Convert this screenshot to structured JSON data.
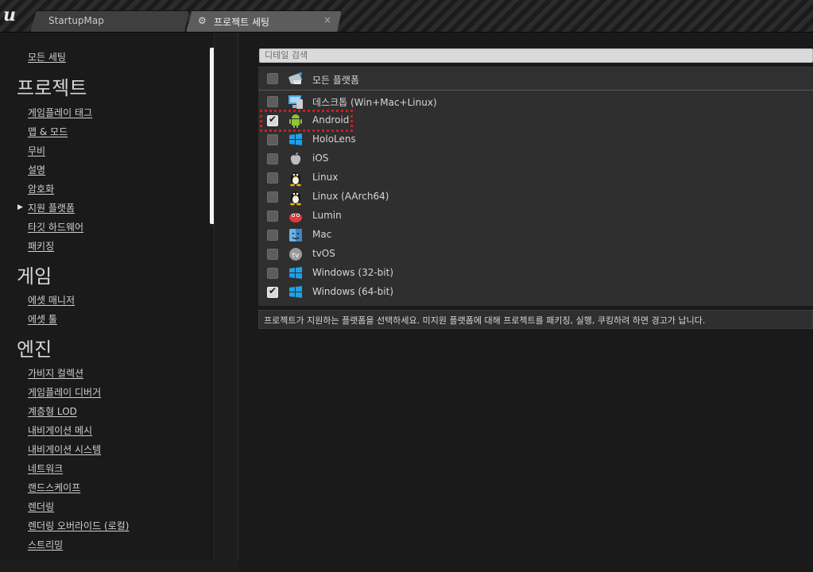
{
  "window": {
    "tabs": [
      {
        "label": "StartupMap",
        "active": false
      },
      {
        "label": "프로젝트 세팅",
        "active": true
      }
    ],
    "close_glyph": "×"
  },
  "sidebar": {
    "all_settings": "모든 세팅",
    "sections": [
      {
        "title": "프로젝트",
        "items": [
          "게임플레이 태그",
          "맵 & 모드",
          "무비",
          "설명",
          "암호화",
          "지원 플랫폼",
          "타깃 하드웨어",
          "패키징"
        ]
      },
      {
        "title": "게임",
        "items": [
          "에셋 매니저",
          "에셋 툴"
        ]
      },
      {
        "title": "엔진",
        "items": [
          "가비지 컬렉션",
          "게임플레이 디버거",
          "계층형 LOD",
          "내비게이션 메시",
          "내비게이션 시스템",
          "네트워크",
          "랜드스케이프",
          "렌더링",
          "렌더링 오버라이드 (로컬)",
          "스트리밍"
        ]
      }
    ],
    "active_item": "지원 플랫폼"
  },
  "details": {
    "search_placeholder": "디테일 검색",
    "header": {
      "label": "모든 플랫폼",
      "checked": false,
      "icon": "all-platforms-icon"
    },
    "platforms": [
      {
        "label": "데스크톱 (Win+Mac+Linux)",
        "checked": false,
        "icon": "desktop-icon"
      },
      {
        "label": "Android",
        "checked": true,
        "icon": "android-icon",
        "highlighted": true
      },
      {
        "label": "HoloLens",
        "checked": false,
        "icon": "windows-icon"
      },
      {
        "label": "iOS",
        "checked": false,
        "icon": "apple-icon"
      },
      {
        "label": "Linux",
        "checked": false,
        "icon": "linux-icon"
      },
      {
        "label": "Linux (AArch64)",
        "checked": false,
        "icon": "linux-icon"
      },
      {
        "label": "Lumin",
        "checked": false,
        "icon": "lumin-icon"
      },
      {
        "label": "Mac",
        "checked": false,
        "icon": "mac-icon"
      },
      {
        "label": "tvOS",
        "checked": false,
        "icon": "tvos-icon"
      },
      {
        "label": "Windows (32-bit)",
        "checked": false,
        "icon": "windows-icon"
      },
      {
        "label": "Windows (64-bit)",
        "checked": true,
        "icon": "windows-icon"
      }
    ],
    "description": "프로젝트가 지원하는 플랫폼을 선택하세요. 미지원 플랫폼에 대해 프로젝트를 패키징, 실행, 쿠킹하려 하면 경고가 납니다."
  },
  "colors": {
    "highlight": "#d21c1c",
    "android": "#8fc43d",
    "windows": "#1ea1e6",
    "lumin": "#e23b3b"
  }
}
